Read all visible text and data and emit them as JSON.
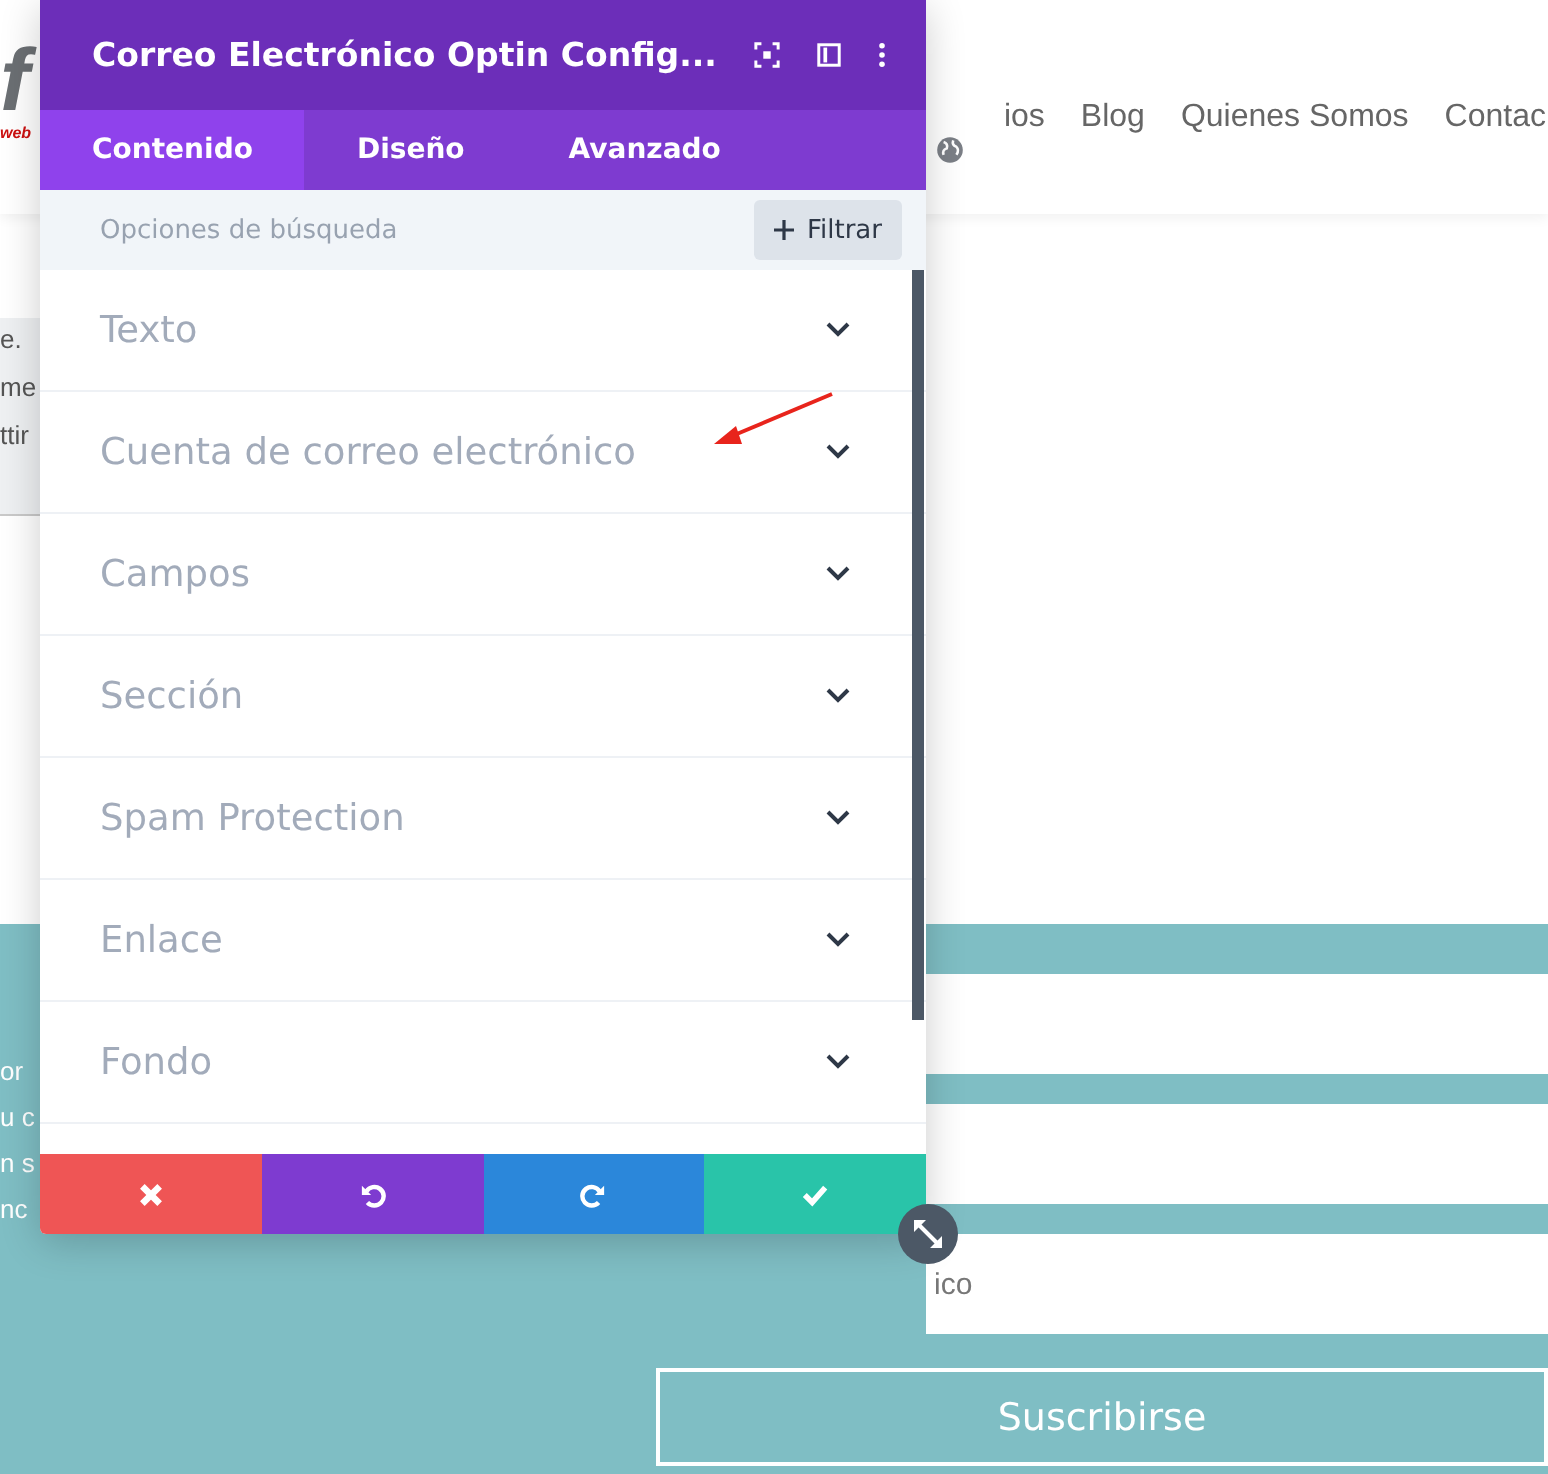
{
  "header": {
    "logo": {
      "mark": "f",
      "word": "web"
    },
    "nav": [
      {
        "label": "ios"
      },
      {
        "label": "Blog"
      },
      {
        "label": "Quienes Somos"
      },
      {
        "label": "Contac"
      }
    ]
  },
  "intro_fragments": [
    "e.",
    "me",
    "ttir"
  ],
  "signup": {
    "text_fragments": [
      "or",
      "u c",
      "n s",
      "nc"
    ],
    "fields": [
      {
        "kind": "blank"
      },
      {
        "kind": "blank"
      },
      {
        "kind": "placeholder",
        "placeholder": "ico"
      }
    ],
    "button": "Suscribirse"
  },
  "panel": {
    "title": "Correo Electrónico Optin Config...",
    "tabs": [
      {
        "label": "Contenido",
        "selected": true
      },
      {
        "label": "Diseño",
        "selected": false
      },
      {
        "label": "Avanzado",
        "selected": false
      }
    ],
    "search": {
      "placeholder": "Opciones de búsqueda"
    },
    "filter_button": "Filtrar",
    "sections": [
      {
        "label": "Texto",
        "expanded": false
      },
      {
        "label": "Cuenta de correo electrónico",
        "expanded": false
      },
      {
        "label": "Campos",
        "expanded": false
      },
      {
        "label": "Sección",
        "expanded": false
      },
      {
        "label": "Spam Protection",
        "expanded": false
      },
      {
        "label": "Enlace",
        "expanded": false
      },
      {
        "label": "Fondo",
        "expanded": false
      }
    ],
    "footer_actions": [
      {
        "kind": "discard"
      },
      {
        "kind": "undo"
      },
      {
        "kind": "redo"
      },
      {
        "kind": "save"
      }
    ]
  }
}
